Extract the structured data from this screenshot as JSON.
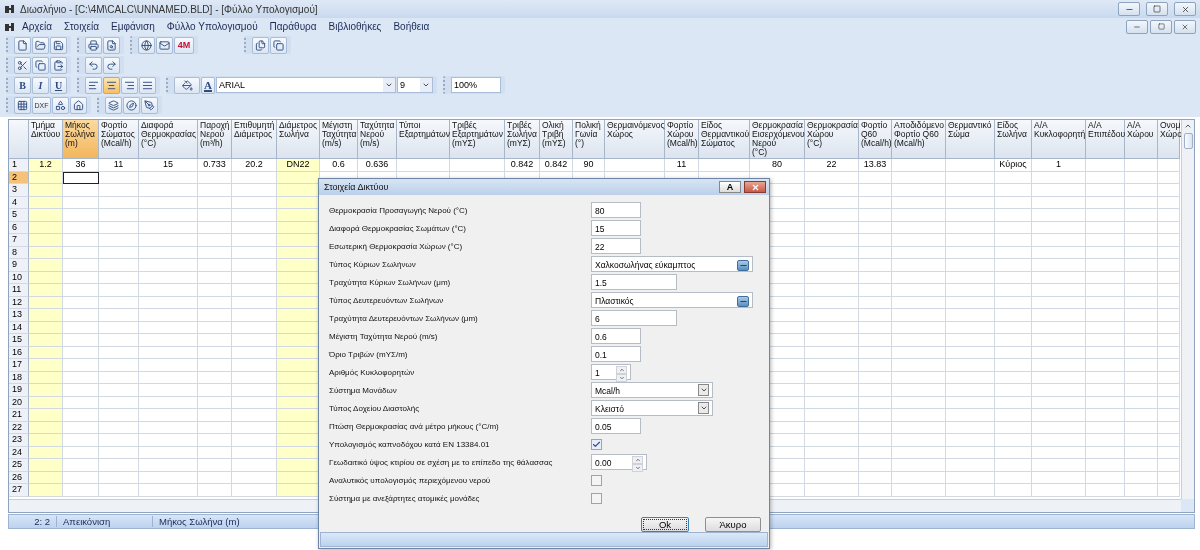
{
  "window": {
    "title": "Διωσλήνιο - [C:\\4M\\CALC\\UNNAMED.BLD] - [Φύλλο Υπολογισμού]"
  },
  "menu": [
    {
      "label": "Αρχεία"
    },
    {
      "label": "Στοιχεία"
    },
    {
      "label": "Εμφάνιση"
    },
    {
      "label": "Φύλλο Υπολογισμού"
    },
    {
      "label": "Παράθυρα"
    },
    {
      "label": "Βιβλιοθήκες"
    },
    {
      "label": "Βοήθεια"
    }
  ],
  "toolbar": {
    "logo_text": "4M",
    "bold": "B",
    "italic": "I",
    "underline": "U",
    "font_color": "A",
    "font": "ARIAL",
    "size": "9",
    "zoom": "100%",
    "dxf": "DXF",
    "align_buttons": [
      {
        "selected": false
      },
      {
        "selected": true
      },
      {
        "selected": false
      },
      {
        "selected": false
      }
    ]
  },
  "table": {
    "columns": [
      {
        "label": "Τμήμα\nΔικτύου",
        "selected": false,
        "shaded": true
      },
      {
        "label": "Μήκος\nΣωλήνα\n(m)",
        "selected": true,
        "shaded": false
      },
      {
        "label": "Φορτίο\nΣώματος\n(Mcal/h)",
        "selected": false,
        "shaded": false
      },
      {
        "label": "Διαφορά\nΘερμοκρασίας\n(°C)",
        "selected": false,
        "shaded": false
      },
      {
        "label": "Παροχή\nΝερού\n(m³/h)",
        "selected": false,
        "shaded": false
      },
      {
        "label": "Επιθυμητή\nΔιάμετρος",
        "selected": false,
        "shaded": false
      },
      {
        "label": "Διάμετρος\nΣωλήνα",
        "selected": false,
        "shaded": true
      },
      {
        "label": "Μέγιστη\nΤαχύτητα\n(m/s)",
        "selected": false,
        "shaded": false
      },
      {
        "label": "Ταχύτητα\nΝερού\n(m/s)",
        "selected": false,
        "shaded": false
      },
      {
        "label": "Τύποι\nΕξαρτημάτων",
        "selected": false,
        "shaded": false
      },
      {
        "label": "Τριβές\nΕξαρτημάτων\n(mΥΣ)",
        "selected": false,
        "shaded": false
      },
      {
        "label": "Τριβές\nΣωλήνα\n(mΥΣ)",
        "selected": false,
        "shaded": false
      },
      {
        "label": "Ολική\nΤριβή\n(mΥΣ)",
        "selected": false,
        "shaded": false
      },
      {
        "label": "Πολική\nΓωνία\n(°)",
        "selected": false,
        "shaded": false
      },
      {
        "label": "Θερμαινόμενος\nΧώρος",
        "selected": false,
        "shaded": false
      },
      {
        "label": "Φορτίο\nΧώρου\n(Mcal/h)",
        "selected": false,
        "shaded": false
      },
      {
        "label": "Είδος\nΘερμαντικού\nΣώματος",
        "selected": false,
        "shaded": false
      },
      {
        "label": "Θερμοκρασία\nΕισερχόμενου\nΝερού\n(°C)",
        "selected": false,
        "shaded": false
      },
      {
        "label": "Θερμοκρασία\nΧώρου\n(°C)",
        "selected": false,
        "shaded": false
      },
      {
        "label": "Φορτίο\nQ60\n(Mcal/h)",
        "selected": false,
        "shaded": false
      },
      {
        "label": "Αποδιδόμενο\nΦορτίο Q60\n(Mcal/h)",
        "selected": false,
        "shaded": false
      },
      {
        "label": "Θερμαντικό\nΣώμα",
        "selected": false,
        "shaded": false
      },
      {
        "label": "Είδος\nΣωλήνα",
        "selected": false,
        "shaded": false
      },
      {
        "label": "Α/Α\nΚυκλοφορητή",
        "selected": false,
        "shaded": false
      },
      {
        "label": "Α/Α\nΕπιπέδου",
        "selected": false,
        "shaded": false
      },
      {
        "label": "Α/Α\nΧώρου",
        "selected": false,
        "shaded": false
      },
      {
        "label": "Ονομ\nΧώρο",
        "selected": false,
        "shaded": false
      }
    ],
    "rows": [
      {
        "label": "1",
        "selected": false,
        "cells": [
          "1.2",
          "36",
          "11",
          "15",
          "0.733",
          "20.2",
          "DN22",
          "0.6",
          "0.636",
          null,
          null,
          "0.842",
          "0.842",
          "90",
          null,
          "11",
          null,
          "80",
          "22",
          "13.83",
          null,
          null,
          "Κύριος",
          "1",
          null,
          null,
          null
        ]
      },
      {
        "label": "2",
        "selected": true
      },
      {
        "label": "3",
        "selected": false
      },
      {
        "label": "4",
        "selected": false
      },
      {
        "label": "5",
        "selected": false
      },
      {
        "label": "6",
        "selected": false
      },
      {
        "label": "7",
        "selected": false
      },
      {
        "label": "8",
        "selected": false
      },
      {
        "label": "9",
        "selected": false
      },
      {
        "label": "10",
        "selected": false
      },
      {
        "label": "11",
        "selected": false
      },
      {
        "label": "12",
        "selected": false
      },
      {
        "label": "13",
        "selected": false
      },
      {
        "label": "14",
        "selected": false
      },
      {
        "label": "15",
        "selected": false
      },
      {
        "label": "16",
        "selected": false
      },
      {
        "label": "17",
        "selected": false
      },
      {
        "label": "18",
        "selected": false
      },
      {
        "label": "19",
        "selected": false
      },
      {
        "label": "20",
        "selected": false
      },
      {
        "label": "21",
        "selected": false
      },
      {
        "label": "22",
        "selected": false
      },
      {
        "label": "23",
        "selected": false
      },
      {
        "label": "24",
        "selected": false
      },
      {
        "label": "25",
        "selected": false
      },
      {
        "label": "26",
        "selected": false
      },
      {
        "label": "27",
        "selected": false
      }
    ]
  },
  "status_bar": {
    "position": "2: 2",
    "mode": "Απεικόνιση",
    "field": "Μήκος Σωλήνα (m)"
  },
  "dialog": {
    "title": "Στοιχεία Δικτύου",
    "title_button": "A",
    "fields": [
      {
        "label": "Θερμοκρασία Προσαγωγής Νερού (°C)",
        "kind": "short",
        "value": "80"
      },
      {
        "label": "Διαφορά Θερμοκρασίας Σωμάτων (°C)",
        "kind": "short",
        "value": "15"
      },
      {
        "label": "Εσωτερική Θερμοκρασία Χώρων (°C)",
        "kind": "short",
        "value": "22"
      },
      {
        "label": "Τύπος Κύριων Σωλήνων",
        "kind": "picker",
        "value": "Χαλκοσωλήνας εύκαμπτος"
      },
      {
        "label": "Τραχύτητα Κύριων Σωλήνων (μm)",
        "kind": "long",
        "value": "1.5"
      },
      {
        "label": "Τύπος Δευτερευόντων Σωλήνων",
        "kind": "picker",
        "value": "Πλαστικός"
      },
      {
        "label": "Τραχύτητα Δευτερευόντων Σωλήνων (μm)",
        "kind": "long",
        "value": "6"
      },
      {
        "label": "Μέγιστη Ταχύτητα Νερού (m/s)",
        "kind": "short",
        "value": "0.6"
      },
      {
        "label": "Όριο Τριβών (mΥΣ/m)",
        "kind": "short",
        "value": "0.1"
      },
      {
        "label": "Αριθμός Κυκλοφορητών",
        "kind": "spin",
        "value": "1"
      },
      {
        "label": "Σύστημα Μονάδων",
        "kind": "dropdown",
        "value": "Mcal/h"
      },
      {
        "label": "Τύπος Δοχείου Διαστολής",
        "kind": "dropdown",
        "value": "Κλειστό"
      },
      {
        "label": "Πτώση Θερμοκρασίας ανά μέτρο μήκους (°C/m)",
        "kind": "short",
        "value": "0.05"
      },
      {
        "label": "Υπολογισμός καπνοδόχου κατά EN 13384.01",
        "kind": "check",
        "checked": true
      },
      {
        "label": "Γεωδαιτικό ύψος κτιρίου σε σχέση με το επίπεδο της θάλασσας",
        "kind": "spin",
        "value": "0.00"
      },
      {
        "label": "Αναλυτικός υπολογισμός περιεχόμενου νερού",
        "kind": "check",
        "checked": false
      },
      {
        "label": "Σύστημα με ανεξάρτητες ατομικές μονάδες",
        "kind": "check",
        "checked": false
      }
    ],
    "buttons": [
      {
        "label": "Ok",
        "focused": true
      },
      {
        "label": "Άκυρο",
        "focused": false
      }
    ]
  }
}
